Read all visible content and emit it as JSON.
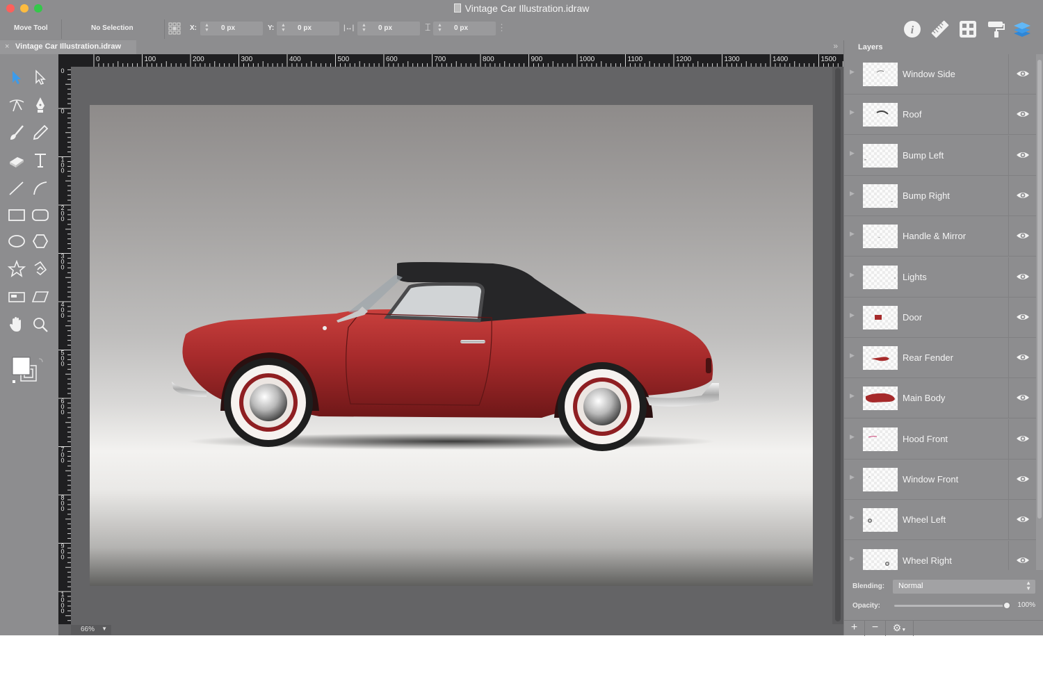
{
  "window": {
    "title": "Vintage Car Illustration.idraw"
  },
  "toolbar": {
    "tool_name": "Move Tool",
    "selection": "No Selection",
    "x_label": "X:",
    "x_value": "0 px",
    "y_label": "Y:",
    "y_value": "0 px",
    "w_value": "0 px",
    "h_value": "0 px",
    "right_icons": [
      "info-icon",
      "ruler-icon",
      "grid-icon",
      "paint-roller-icon",
      "layers-icon"
    ]
  },
  "tab": {
    "label": "Vintage Car Illustration.idraw",
    "close": "×",
    "overflow": "»"
  },
  "ruler": {
    "h_labels": [
      "0",
      "100",
      "200",
      "300",
      "400",
      "500",
      "600",
      "700",
      "800",
      "900",
      "1000",
      "1100",
      "1200",
      "1300",
      "1400",
      "1500"
    ],
    "v_labels": [
      "0",
      "0",
      "100",
      "200",
      "300",
      "400",
      "500",
      "600",
      "700",
      "800",
      "900",
      "1000"
    ]
  },
  "status": {
    "zoom": "66%"
  },
  "layers": {
    "title": "Layers",
    "items": [
      {
        "name": "Window Side"
      },
      {
        "name": "Roof"
      },
      {
        "name": "Bump Left"
      },
      {
        "name": "Bump Right"
      },
      {
        "name": "Handle & Mirror"
      },
      {
        "name": "Lights"
      },
      {
        "name": "Door"
      },
      {
        "name": "Rear Fender"
      },
      {
        "name": "Main Body"
      },
      {
        "name": "Hood Front"
      },
      {
        "name": "Window Front"
      },
      {
        "name": "Wheel Left"
      },
      {
        "name": "Wheel Right"
      }
    ],
    "blending_label": "Blending:",
    "blending_value": "Normal",
    "opacity_label": "Opacity:",
    "opacity_value": "100%",
    "opacity_level": 1.0,
    "footer": {
      "add": "+",
      "remove": "−",
      "gear": "⚙"
    }
  },
  "colors": {
    "chrome": "#8d8d8f",
    "canvas": "#646466",
    "car_body": "#a62a2b",
    "car_roof": "#262628",
    "close_button": "#fc605b",
    "minimize_button": "#fdbc40",
    "zoom_button": "#34c84a",
    "accent_icon": "#3d9bea"
  }
}
